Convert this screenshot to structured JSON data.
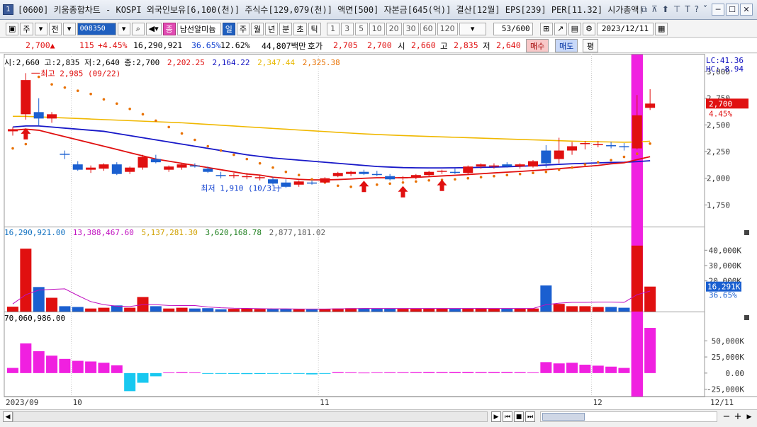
{
  "window": {
    "badge": "1",
    "title": "[0600] 키움종합차트 - KOSPI 외국인보유[6,100(천)] 주식수[129,079(천)] 액면[500] 자본금[645(억)] 결산[12월] EPS[239] PER[11.32] 시가총액[3,485(억",
    "tool_icons": [
      "⧉",
      "⊼",
      "⬆",
      "⊤",
      "T",
      "?",
      "˅"
    ],
    "min_icon": "─",
    "max_icon": "☐",
    "close_icon": "✕"
  },
  "toolbar": {
    "market": "주",
    "prev": "전",
    "code": "008350",
    "name": "남선알미늄",
    "periods": [
      "일",
      "주",
      "월",
      "년",
      "분",
      "초",
      "틱"
    ],
    "selected_period": "일",
    "minutes": [
      "1",
      "3",
      "5",
      "10",
      "20",
      "30",
      "60",
      "120"
    ],
    "count": "53/600",
    "date": "2023/12/11"
  },
  "quote": {
    "price": "2,700▲",
    "change": "115",
    "change_pct": "+4.45%",
    "volume": "16,290,921",
    "vol_ratio": "36.65%",
    "turnover": "12.62%",
    "amount": "44,807백만",
    "hoga_label": "호가",
    "ask": "2,705",
    "bid": "2,700",
    "open_label": "시",
    "open": "2,660",
    "high_label": "고",
    "high": "2,835",
    "low_label": "저",
    "low": "2,640",
    "sell_button": "매수",
    "buy_button": "매도",
    "eval_button": "평"
  },
  "price_panel": {
    "ohlc": "시:2,660 고:2,835 저:2,640 종:2,700",
    "ma_values": [
      {
        "text": "2,202.25",
        "color": "#e01010"
      },
      {
        "text": "2,164.22",
        "color": "#1010c0"
      },
      {
        "text": "2,347.44",
        "color": "#e8b800"
      },
      {
        "text": "2,325.38",
        "color": "#e87000"
      }
    ],
    "lc": "LC:41.36",
    "hc": "HC:-8.94",
    "y_ticks": [
      "3,000",
      "2,750",
      "2,500",
      "2,250",
      "2,000",
      "1,750"
    ],
    "last_price_label": "2,700",
    "last_pct_label": "4.45%",
    "high_annotation": "최고 2,985 (09/22)",
    "low_annotation": "최저 1,910 (10/31)"
  },
  "volume_panel": {
    "values": [
      {
        "text": "16,290,921.00",
        "color": "#1070c0"
      },
      {
        "text": "13,388,467.60",
        "color": "#c010c0"
      },
      {
        "text": "5,137,281.30",
        "color": "#d0a000"
      },
      {
        "text": "3,620,168.78",
        "color": "#208020"
      },
      {
        "text": "2,877,181.02",
        "color": "#606060"
      }
    ],
    "y_ticks": [
      "40,000K",
      "30,000K",
      "20,000K"
    ],
    "last_label": "16,291K",
    "last_pct": "36.65%"
  },
  "obv_panel": {
    "value": "70,060,986.00",
    "y_ticks": [
      "50,000K",
      "25,000K",
      "0.00",
      "-25,000K"
    ]
  },
  "x_axis": {
    "labels": [
      "2023/09",
      "10",
      "11",
      "12",
      "12/11"
    ]
  },
  "scroll": {
    "buttons": [
      "▶",
      "⏮",
      "■",
      "⏭"
    ],
    "zoom_out": "−",
    "zoom_in": "+",
    "slider_left": "◀",
    "slider_right": "▶"
  },
  "chart_data": {
    "type": "candlestick",
    "candles": [
      {
        "o": 2440,
        "h": 2480,
        "l": 2400,
        "c": 2460
      },
      {
        "o": 2600,
        "h": 2985,
        "l": 2550,
        "c": 2920
      },
      {
        "o": 2620,
        "h": 2750,
        "l": 2490,
        "c": 2560
      },
      {
        "o": 2560,
        "h": 2620,
        "l": 2520,
        "c": 2600
      },
      {
        "o": 2230,
        "h": 2260,
        "l": 2180,
        "c": 2220
      },
      {
        "o": 2130,
        "h": 2160,
        "l": 2070,
        "c": 2080
      },
      {
        "o": 2080,
        "h": 2120,
        "l": 2050,
        "c": 2100
      },
      {
        "o": 2090,
        "h": 2140,
        "l": 2070,
        "c": 2130
      },
      {
        "o": 2130,
        "h": 2150,
        "l": 2030,
        "c": 2040
      },
      {
        "o": 2060,
        "h": 2110,
        "l": 2040,
        "c": 2100
      },
      {
        "o": 2100,
        "h": 2220,
        "l": 2080,
        "c": 2200
      },
      {
        "o": 2180,
        "h": 2220,
        "l": 2140,
        "c": 2150
      },
      {
        "o": 2080,
        "h": 2120,
        "l": 2060,
        "c": 2110
      },
      {
        "o": 2100,
        "h": 2140,
        "l": 2080,
        "c": 2130
      },
      {
        "o": 2120,
        "h": 2140,
        "l": 2100,
        "c": 2110
      },
      {
        "o": 2090,
        "h": 2110,
        "l": 2050,
        "c": 2060
      },
      {
        "o": 2030,
        "h": 2060,
        "l": 2000,
        "c": 2020
      },
      {
        "o": 2020,
        "h": 2050,
        "l": 2000,
        "c": 2030
      },
      {
        "o": 2010,
        "h": 2050,
        "l": 1990,
        "c": 2020
      },
      {
        "o": 2000,
        "h": 2030,
        "l": 1980,
        "c": 2010
      },
      {
        "o": 1990,
        "h": 2010,
        "l": 1940,
        "c": 1950
      },
      {
        "o": 1960,
        "h": 1990,
        "l": 1910,
        "c": 1920
      },
      {
        "o": 1940,
        "h": 1980,
        "l": 1920,
        "c": 1970
      },
      {
        "o": 1960,
        "h": 1980,
        "l": 1940,
        "c": 1950
      },
      {
        "o": 1960,
        "h": 2010,
        "l": 1950,
        "c": 2000
      },
      {
        "o": 2020,
        "h": 2060,
        "l": 2010,
        "c": 2050
      },
      {
        "o": 2040,
        "h": 2070,
        "l": 2020,
        "c": 2060
      },
      {
        "o": 2060,
        "h": 2080,
        "l": 2030,
        "c": 2040
      },
      {
        "o": 2040,
        "h": 2070,
        "l": 2020,
        "c": 2030
      },
      {
        "o": 2020,
        "h": 2040,
        "l": 1980,
        "c": 1990
      },
      {
        "o": 2000,
        "h": 2020,
        "l": 1980,
        "c": 2010
      },
      {
        "o": 2010,
        "h": 2040,
        "l": 1990,
        "c": 2030
      },
      {
        "o": 2030,
        "h": 2070,
        "l": 2020,
        "c": 2060
      },
      {
        "o": 2060,
        "h": 2080,
        "l": 2040,
        "c": 2070
      },
      {
        "o": 2060,
        "h": 2090,
        "l": 2040,
        "c": 2050
      },
      {
        "o": 2050,
        "h": 2120,
        "l": 2040,
        "c": 2110
      },
      {
        "o": 2110,
        "h": 2140,
        "l": 2090,
        "c": 2130
      },
      {
        "o": 2110,
        "h": 2140,
        "l": 2090,
        "c": 2120
      },
      {
        "o": 2130,
        "h": 2150,
        "l": 2100,
        "c": 2110
      },
      {
        "o": 2110,
        "h": 2140,
        "l": 2090,
        "c": 2130
      },
      {
        "o": 2110,
        "h": 2170,
        "l": 2100,
        "c": 2160
      },
      {
        "o": 2260,
        "h": 2310,
        "l": 2100,
        "c": 2140
      },
      {
        "o": 2180,
        "h": 2380,
        "l": 2140,
        "c": 2260
      },
      {
        "o": 2260,
        "h": 2340,
        "l": 2220,
        "c": 2300
      },
      {
        "o": 2320,
        "h": 2350,
        "l": 2270,
        "c": 2330
      },
      {
        "o": 2310,
        "h": 2350,
        "l": 2290,
        "c": 2320
      },
      {
        "o": 2310,
        "h": 2340,
        "l": 2280,
        "c": 2300
      },
      {
        "o": 2300,
        "h": 2330,
        "l": 2260,
        "c": 2290
      },
      {
        "o": 2280,
        "h": 2780,
        "l": 2270,
        "c": 2590
      },
      {
        "o": 2660,
        "h": 2835,
        "l": 2640,
        "c": 2700
      }
    ],
    "ma_red": [
      2450,
      2460,
      2450,
      2420,
      2390,
      2360,
      2330,
      2300,
      2270,
      2240,
      2210,
      2180,
      2160,
      2140,
      2120,
      2100,
      2080,
      2060,
      2040,
      2030,
      2010,
      2000,
      1990,
      1985,
      1985,
      1988,
      1993,
      2000,
      2005,
      2005,
      2005,
      2008,
      2015,
      2022,
      2028,
      2035,
      2042,
      2050,
      2057,
      2064,
      2072,
      2080,
      2090,
      2100,
      2110,
      2120,
      2135,
      2145,
      2175,
      2202
    ],
    "ma_blue": [
      2480,
      2490,
      2490,
      2480,
      2470,
      2460,
      2450,
      2440,
      2420,
      2400,
      2380,
      2360,
      2340,
      2320,
      2300,
      2280,
      2260,
      2240,
      2220,
      2205,
      2190,
      2180,
      2170,
      2160,
      2150,
      2140,
      2130,
      2120,
      2110,
      2105,
      2100,
      2098,
      2097,
      2097,
      2098,
      2100,
      2102,
      2105,
      2108,
      2112,
      2118,
      2124,
      2130,
      2136,
      2140,
      2144,
      2148,
      2150,
      2156,
      2164
    ],
    "ma_yellow": [
      2580,
      2580,
      2575,
      2570,
      2565,
      2560,
      2555,
      2550,
      2545,
      2540,
      2535,
      2530,
      2525,
      2520,
      2512,
      2505,
      2497,
      2490,
      2482,
      2475,
      2467,
      2460,
      2452,
      2445,
      2438,
      2430,
      2423,
      2416,
      2410,
      2405,
      2400,
      2396,
      2392,
      2388,
      2384,
      2380,
      2376,
      2372,
      2368,
      2364,
      2360,
      2356,
      2352,
      2348,
      2345,
      2342,
      2340,
      2338,
      2340,
      2347
    ],
    "sar": [
      2280,
      2320,
      2950,
      2880,
      2850,
      2820,
      2790,
      2740,
      2700,
      2650,
      2600,
      2540,
      2480,
      2420,
      2360,
      2300,
      2260,
      2220,
      2180,
      2140,
      2100,
      2060,
      2030,
      1990,
      1960,
      1930,
      1920,
      1930,
      1940,
      1950,
      1960,
      1970,
      1980,
      1985,
      1990,
      2000,
      2010,
      2020,
      2030,
      2040,
      2050,
      2060,
      2080,
      2100,
      2130,
      2150,
      2170,
      2200,
      2230,
      2325
    ],
    "volume": [
      3200,
      41000,
      16000,
      9000,
      3500,
      3000,
      2000,
      2500,
      4000,
      2500,
      9500,
      3500,
      2000,
      2500,
      2000,
      2200,
      1500,
      1800,
      2000,
      1700,
      1600,
      1800,
      1500,
      1400,
      1600,
      2000,
      2200,
      2200,
      2000,
      1900,
      1800,
      1800,
      2000,
      2000,
      1900,
      2100,
      2200,
      2000,
      2000,
      2000,
      2000,
      17000,
      5000,
      3500,
      3500,
      3000,
      3000,
      2500,
      43000,
      16291
    ],
    "vol_ma": [
      5000,
      11000,
      14000,
      14500,
      14800,
      10500,
      6500,
      4500,
      3500,
      3300,
      4500,
      4500,
      4000,
      3900,
      3900,
      3000,
      2500,
      2200,
      2100,
      1900,
      1800,
      1800,
      1700,
      1700,
      1700,
      1800,
      1900,
      2000,
      2000,
      2000,
      2000,
      2000,
      2000,
      2000,
      2000,
      2000,
      2000,
      2000,
      2000,
      2000,
      2000,
      4500,
      5500,
      6000,
      6000,
      6200,
      6200,
      6000,
      11000,
      13388
    ],
    "obv": [
      8000,
      46000,
      34000,
      27000,
      22000,
      19000,
      18000,
      16000,
      12000,
      -28000,
      -15000,
      -5000,
      1000,
      1500,
      1000,
      -200,
      -1000,
      -1200,
      -1500,
      -1300,
      -700,
      -400,
      -1100,
      -2000,
      -600,
      1500,
      1200,
      800,
      1100,
      1300,
      1300,
      1500,
      1700,
      1600,
      1800,
      1800,
      1600,
      1700,
      1700,
      1500,
      1100,
      17000,
      15000,
      16000,
      13000,
      11500,
      10000,
      8000,
      55000,
      70060
    ],
    "price_range": [
      1600,
      3100
    ],
    "volume_range": [
      0,
      48000
    ],
    "obv_range": [
      -32000,
      80000
    ]
  }
}
